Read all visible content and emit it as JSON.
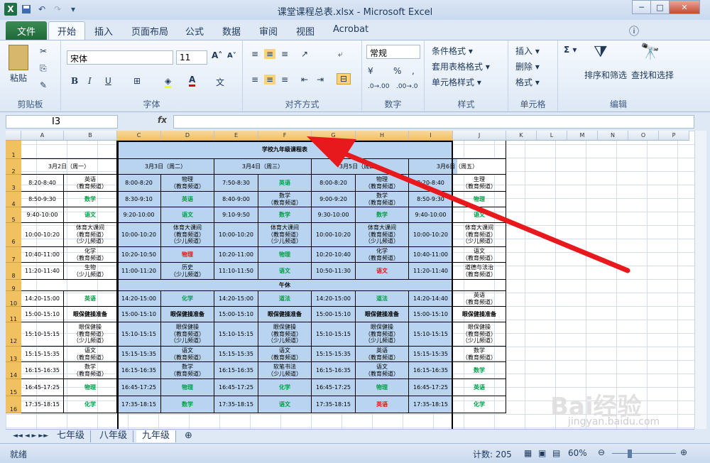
{
  "window": {
    "title": "课堂课程总表.xlsx  -  Microsoft Excel",
    "min": "─",
    "max": "□",
    "close": "✕"
  },
  "qat": {
    "app_icon": "X",
    "save_icon": "save-icon",
    "undo_icon": "↶",
    "redo_icon": "↷",
    "more": "▾"
  },
  "tabs": [
    "文件",
    "开始",
    "插入",
    "页面布局",
    "公式",
    "数据",
    "审阅",
    "视图",
    "Acrobat"
  ],
  "ribbon": {
    "clipboard": {
      "paste": "粘贴",
      "label": "剪贴板"
    },
    "font": {
      "name": "宋体",
      "size": "11",
      "bold": "B",
      "italic": "I",
      "underline": "U",
      "grow": "A˄",
      "shrink": "A˅",
      "color_a": "A",
      "label": "字体"
    },
    "align": {
      "label": "对齐方式"
    },
    "number": {
      "format": "常规",
      "percent": "%",
      "comma": ",",
      "label": "数字"
    },
    "styles": {
      "cond": "条件格式 ▾",
      "table": "套用表格格式 ▾",
      "cell": "单元格样式 ▾",
      "label": "样式"
    },
    "cells": {
      "insert": "插入 ▾",
      "delete": "删除 ▾",
      "format": "格式 ▾",
      "label": "单元格"
    },
    "editing": {
      "sigma": "Σ ▾",
      "sort": "排序和筛选",
      "find": "查找和选择",
      "label": "编辑"
    }
  },
  "formula": {
    "namebox": "I3",
    "fx": "fx",
    "content": ""
  },
  "columns": [
    "A",
    "B",
    "C",
    "D",
    "E",
    "F",
    "G",
    "H",
    "I",
    "J",
    "K",
    "L",
    "M",
    "N",
    "O",
    "P"
  ],
  "rows": [
    "1",
    "2",
    "3",
    "4",
    "5",
    "6",
    "7",
    "8",
    "9",
    "10",
    "11",
    "12",
    "13",
    "14",
    "15",
    "16"
  ],
  "table": {
    "title": "学校九年级课程表",
    "dates": [
      "3月2日（周一）",
      "3月3日（周二）",
      "3月4日（周三）",
      "3月5日（周四）",
      "3月6日（周五）"
    ],
    "row3": [
      "8:20-8:40",
      "英语\n（教育频道）",
      "8:00-8:20",
      "物理\n（教育频道）",
      "7:50-8:30",
      "英语",
      "8:00-8:20",
      "物理\n（教育频道）",
      "8:20-8:40",
      "生理\n（教育频道）"
    ],
    "row4": [
      "8:50-9:30",
      "数学",
      "8:30-9:10",
      "英语",
      "8:40-9:00",
      "数学\n（教育频道）",
      "9:00-9:20",
      "数学\n（教育频道）",
      "8:50-9:30",
      "物理"
    ],
    "row5": [
      "9:40-10:00",
      "语文",
      "9:20-10:00",
      "语文",
      "9:10-9:50",
      "数学",
      "9:30-10:00",
      "数学",
      "9:40-10:00",
      "语文"
    ],
    "row6": [
      "10:00-10:20",
      "体育大课间\n（教育频道）\n（少儿频道）",
      "10:00-10:20",
      "体育大课间\n（教育频道）\n（少儿频道）",
      "10:00-10:20",
      "体育大课间\n（教育频道）\n（少儿频道）",
      "10:00-10:20",
      "体育大课间\n（教育频道）\n（少儿频道）",
      "10:00-10:20",
      "体育大课间\n（教育频道）\n（少儿频道）"
    ],
    "row7": [
      "10:40-11:00",
      "化学\n（教育频道）",
      "10:20-10:50",
      "物理",
      "10:20-11:00",
      "物理",
      "10:20-10:40",
      "化学\n（教育频道）",
      "10:40-11:00",
      "语文\n（教育频道）"
    ],
    "row8": [
      "11:20-11:40",
      "生物\n（少儿频道）",
      "11:00-11:20",
      "历史\n（少儿频道）",
      "11:10-11:50",
      "语文",
      "10:50-11:30",
      "语文",
      "11:20-11:40",
      "道德与法治\n（教育频道）"
    ],
    "row9": "午休",
    "row10": [
      "14:20-15:00",
      "英语",
      "14:20-15:00",
      "化学",
      "14:20-15:00",
      "道法",
      "14:20-15:00",
      "道法",
      "14:20-14:40",
      "英语\n（教育频道）"
    ],
    "row11": [
      "15:00-15:10",
      "眼保健操准备",
      "15:00-15:10",
      "眼保健操准备",
      "15:00-15:10",
      "眼保健操准备",
      "15:00-15:10",
      "眼保健操准备",
      "15:00-15:10",
      "眼保健操准备"
    ],
    "row12": [
      "15:10-15:15",
      "眼保健操\n（教育频道）\n（少儿频道）",
      "15:10-15:15",
      "眼保健操\n（教育频道）\n（少儿频道）",
      "15:10-15:15",
      "眼保健操\n（教育频道）\n（少儿频道）",
      "15:10-15:15",
      "眼保健操\n（教育频道）\n（少儿频道）",
      "15:10-15:15",
      "眼保健操\n（教育频道）\n（少儿频道）"
    ],
    "row13": [
      "15:15-15:35",
      "语文\n（教育频道）",
      "15:15-15:35",
      "语文\n（教育频道）",
      "15:15-15:35",
      "语文\n（教育频道）",
      "15:15-15:35",
      "英语\n（教育频道）",
      "15:15-15:35",
      "数学\n（教育频道）"
    ],
    "row14": [
      "16:15-16:35",
      "数学\n（教育频道）",
      "16:15-16:35",
      "数学\n（教育频道）",
      "16:15-16:35",
      "软笔书法\n（少儿频道）",
      "16:15-16:35",
      "语文\n（教育频道）",
      "16:15-16:35",
      "数学"
    ],
    "row15": [
      "16:45-17:25",
      "物理",
      "16:45-17:25",
      "物理",
      "16:45-17:25",
      "化学",
      "16:45-17:25",
      "物理",
      "16:45-17:25",
      "英语"
    ],
    "row16": [
      "17:35-18:15",
      "化学",
      "17:35-18:15",
      "数学",
      "17:35-18:15",
      "语文",
      "17:35-18:15",
      "英语",
      "17:35-18:15",
      "化学"
    ]
  },
  "sheets": [
    "七年级",
    "八年级",
    "九年级"
  ],
  "status": {
    "ready": "就绪",
    "count": "计数: 205",
    "zoom": "60%"
  },
  "watermark": {
    "brand": "Bai经验",
    "url": "jingyan.baidu.com"
  }
}
